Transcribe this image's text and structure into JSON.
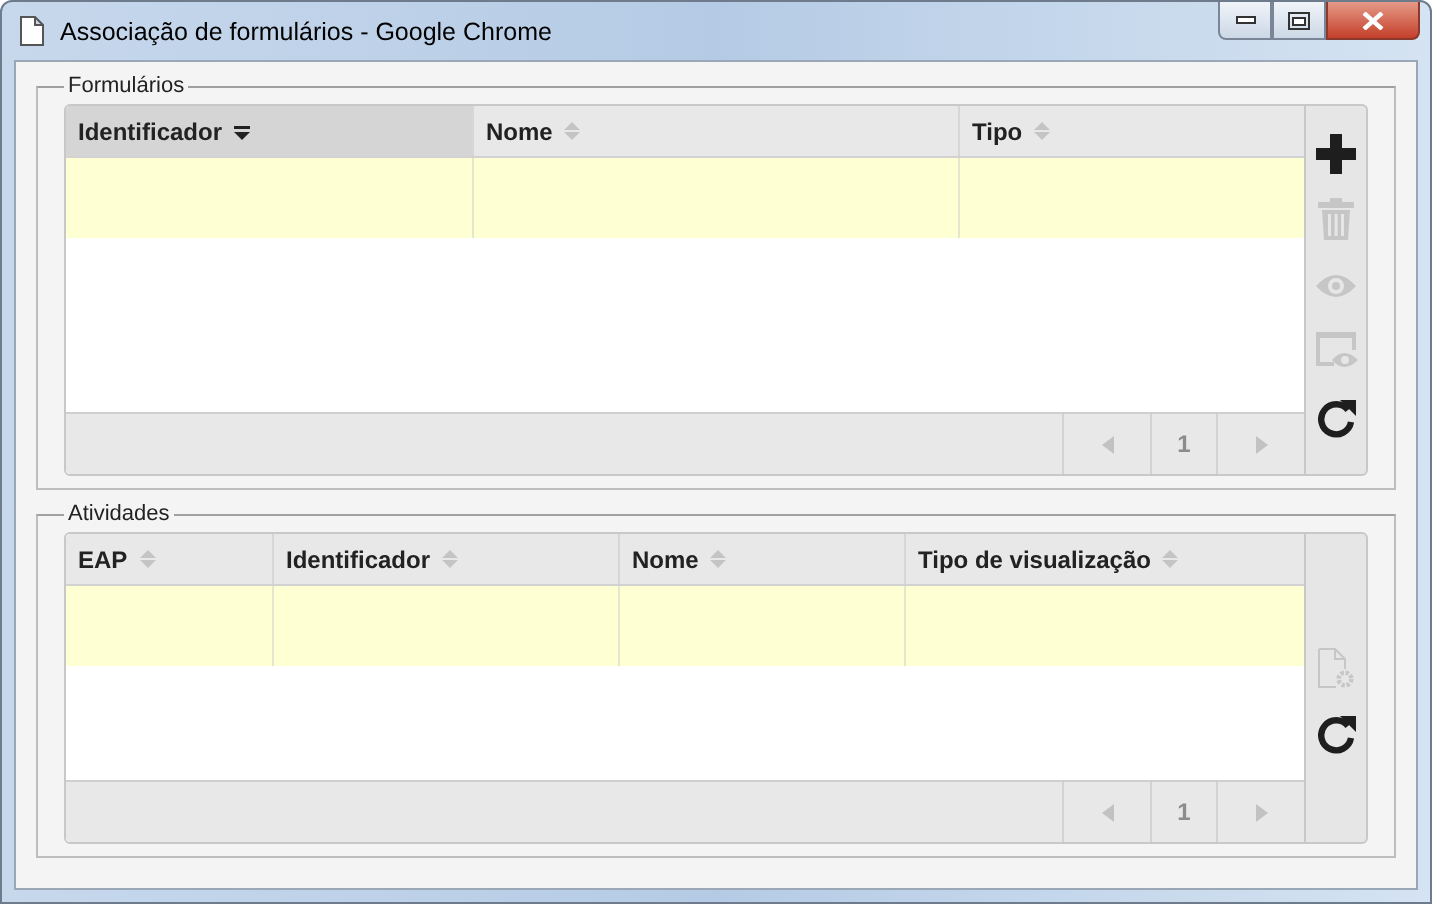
{
  "window": {
    "title": "Associação de formulários - Google Chrome"
  },
  "sections": [
    {
      "legend": "Formulários",
      "columns": [
        {
          "label": "Identificador",
          "sorted": true
        },
        {
          "label": "Nome",
          "sorted": false
        },
        {
          "label": "Tipo",
          "sorted": false
        }
      ],
      "rows": [
        {
          "selected": true
        }
      ],
      "pager": {
        "page": "1",
        "prev_disabled": true,
        "next_disabled": true
      },
      "toolbar": [
        {
          "kind": "add",
          "disabled": false
        },
        {
          "kind": "delete",
          "disabled": true
        },
        {
          "kind": "view",
          "disabled": true
        },
        {
          "kind": "preview",
          "disabled": true
        },
        {
          "kind": "refresh",
          "disabled": false
        }
      ]
    },
    {
      "legend": "Atividades",
      "columns": [
        {
          "label": "EAP",
          "sorted": false
        },
        {
          "label": "Identificador",
          "sorted": false
        },
        {
          "label": "Nome",
          "sorted": false
        },
        {
          "label": "Tipo de visualização",
          "sorted": false
        }
      ],
      "rows": [
        {
          "selected": true
        }
      ],
      "pager": {
        "page": "1",
        "prev_disabled": true,
        "next_disabled": true
      },
      "toolbar": [
        {
          "kind": "file-settings",
          "disabled": true
        },
        {
          "kind": "refresh",
          "disabled": false
        }
      ]
    }
  ]
}
